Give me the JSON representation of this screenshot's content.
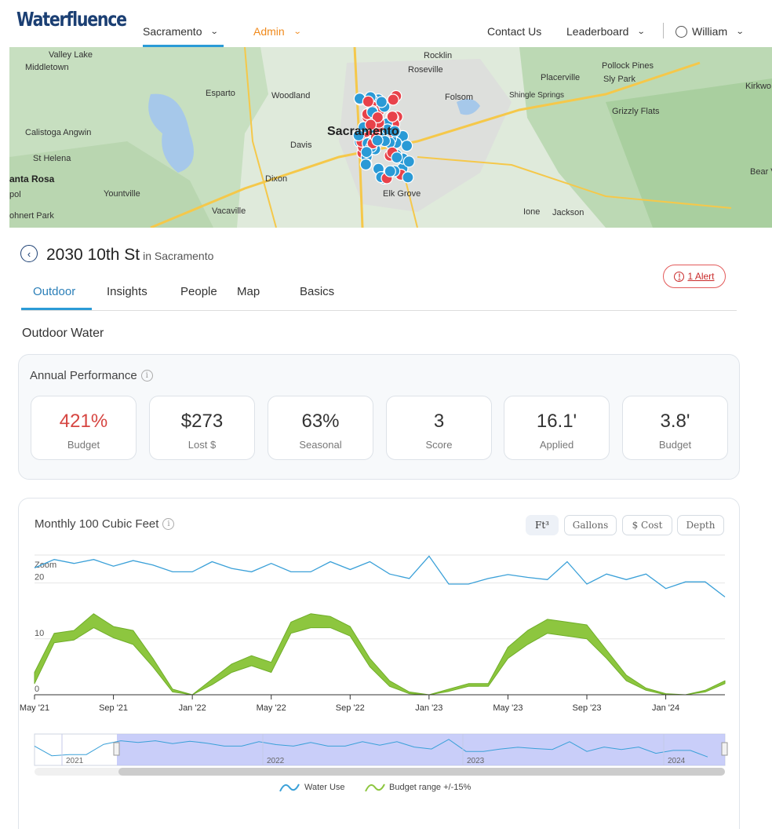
{
  "header": {
    "logo": "Waterfluence",
    "nav": {
      "region": "Sacramento",
      "admin": "Admin",
      "contact": "Contact Us",
      "leaderboard": "Leaderboard",
      "user": "William"
    }
  },
  "map": {
    "labels": [
      {
        "text": "Valley Lake"
      },
      {
        "text": "Middletown"
      },
      {
        "text": "Esparto"
      },
      {
        "text": "Woodland"
      },
      {
        "text": "Rocklin"
      },
      {
        "text": "Roseville"
      },
      {
        "text": "Folsom"
      },
      {
        "text": "Shingle Springs"
      },
      {
        "text": "Placerville"
      },
      {
        "text": "Pollock Pines"
      },
      {
        "text": "Sly Park"
      },
      {
        "text": "Grizzly Flats"
      },
      {
        "text": "Kirkwo"
      },
      {
        "text": "Calistoga Angwin"
      },
      {
        "text": "St Helena"
      },
      {
        "text": "Davis"
      },
      {
        "text": "Sacramento"
      },
      {
        "text": "anta Rosa"
      },
      {
        "text": "Yountville"
      },
      {
        "text": "Dixon"
      },
      {
        "text": "Elk Grove"
      },
      {
        "text": "Vacaville"
      },
      {
        "text": "ohnert Park"
      },
      {
        "text": "Ione"
      },
      {
        "text": "Jackson"
      },
      {
        "text": "Bear V"
      },
      {
        "text": "pol"
      }
    ]
  },
  "property": {
    "address": "2030 10th St",
    "city": "in Sacramento",
    "alert": "1 Alert"
  },
  "tabs": [
    "Outdoor",
    "Insights",
    "People",
    "Map",
    "Basics"
  ],
  "section_title": "Outdoor Water",
  "annual": {
    "title": "Annual Performance",
    "stats": [
      {
        "value": "421%",
        "label": "Budget"
      },
      {
        "value": "$273",
        "label": "Lost $"
      },
      {
        "value": "63%",
        "label": "Seasonal"
      },
      {
        "value": "3",
        "label": "Score"
      },
      {
        "value": "16.1'",
        "label": "Applied"
      },
      {
        "value": "3.8'",
        "label": "Budget"
      }
    ]
  },
  "chart": {
    "title": "Monthly 100 Cubic Feet",
    "units": [
      "Ft³",
      "Gallons",
      "$ Cost",
      "Depth"
    ],
    "zoom_label": "Zoom",
    "legend": [
      "Water Use",
      "Budget range +/-15%"
    ],
    "navigator_years": [
      "2021",
      "2022",
      "2023",
      "2024"
    ]
  },
  "chart_data": {
    "type": "area",
    "title": "Monthly 100 Cubic Feet",
    "x_ticks": [
      "May '21",
      "Sep '21",
      "Jan '22",
      "May '22",
      "Sep '22",
      "Jan '23",
      "May '23",
      "Sep '23",
      "Jan '24"
    ],
    "y_ticks": [
      0,
      10,
      20
    ],
    "ylim": [
      0,
      25
    ],
    "x": [
      "2021-05",
      "2021-06",
      "2021-07",
      "2021-08",
      "2021-09",
      "2021-10",
      "2021-11",
      "2021-12",
      "2022-01",
      "2022-02",
      "2022-03",
      "2022-04",
      "2022-05",
      "2022-06",
      "2022-07",
      "2022-08",
      "2022-09",
      "2022-10",
      "2022-11",
      "2022-12",
      "2023-01",
      "2023-02",
      "2023-03",
      "2023-04",
      "2023-05",
      "2023-06",
      "2023-07",
      "2023-08",
      "2023-09",
      "2023-10",
      "2023-11",
      "2023-12",
      "2024-01",
      "2024-02",
      "2024-03",
      "2024-04"
    ],
    "series": [
      {
        "name": "Water Use",
        "type": "line",
        "color": "#3aa0d8",
        "values": [
          22.7,
          24.2,
          23.5,
          24.2,
          23.0,
          24.0,
          23.2,
          22.0,
          22.0,
          23.8,
          22.6,
          22.0,
          23.5,
          22.0,
          22.0,
          23.8,
          22.4,
          23.8,
          21.6,
          20.8,
          24.8,
          19.8,
          19.8,
          20.8,
          21.5,
          21.0,
          20.6,
          23.8,
          19.8,
          21.6,
          20.6,
          21.6,
          19.0,
          20.2,
          20.2,
          17.5
        ]
      },
      {
        "name": "Budget range +/-15%",
        "type": "range",
        "color": "#8dc63f",
        "low": [
          2.0,
          9.3,
          9.8,
          12.0,
          10.2,
          9.0,
          5.0,
          0.5,
          0.0,
          1.8,
          4.0,
          5.2,
          4.0,
          11.0,
          12.0,
          12.0,
          10.5,
          5.0,
          1.5,
          0.2,
          0.0,
          0.6,
          1.5,
          1.5,
          6.5,
          9.0,
          11.0,
          10.5,
          10.0,
          6.5,
          2.5,
          0.8,
          0.0,
          0.0,
          0.5,
          2.0
        ],
        "high": [
          4.0,
          11.0,
          11.5,
          14.5,
          12.2,
          11.5,
          6.5,
          1.0,
          0.0,
          2.8,
          5.5,
          7.0,
          5.8,
          13.0,
          14.5,
          14.0,
          12.2,
          6.5,
          2.5,
          0.5,
          0.0,
          1.0,
          2.0,
          2.0,
          8.5,
          11.5,
          13.5,
          13.0,
          12.5,
          8.0,
          3.5,
          1.2,
          0.2,
          0.0,
          0.8,
          2.5
        ]
      }
    ]
  }
}
